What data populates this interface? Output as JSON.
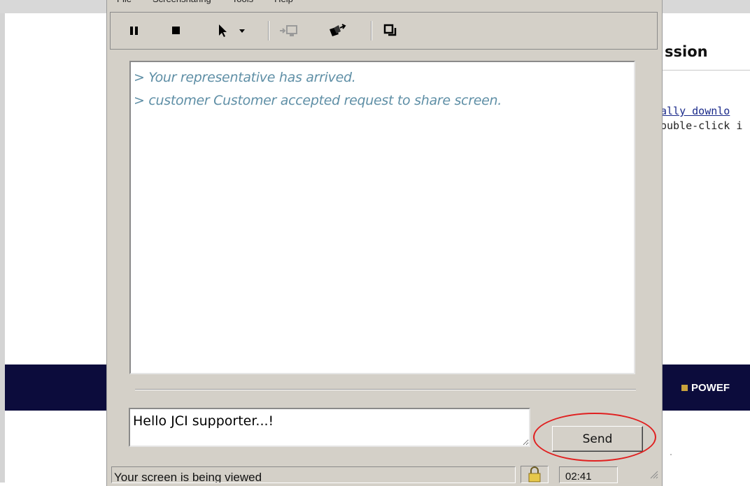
{
  "background_page": {
    "heading_fragment": "ssion",
    "link_fragment": "ally downlo",
    "text_fragment": "ouble-click i",
    "nav_fragment": "POWEF"
  },
  "window": {
    "menu": [
      "File",
      "Screensharing",
      "Tools",
      "Help"
    ],
    "toolbar": [
      {
        "name": "pause-icon"
      },
      {
        "name": "stop-icon"
      },
      {
        "name": "pointer-icon"
      },
      {
        "name": "dropdown-arrow-icon"
      },
      {
        "name": "transfer-to-screen-icon"
      },
      {
        "name": "send-files-icon"
      },
      {
        "name": "windows-icon"
      }
    ],
    "chat_messages": [
      "> Your representative has arrived.",
      "> customer Customer accepted request to share screen."
    ],
    "chat_input_value": "Hello JCI supporter...!",
    "send_label": "Send",
    "status_text": "Your screen is being viewed",
    "status_time": "02:41"
  },
  "colors": {
    "window_bg": "#d4d0c8",
    "message_text": "#5f8fa6",
    "nav_band": "#0c0c3c",
    "annotation_circle": "#e02020"
  }
}
